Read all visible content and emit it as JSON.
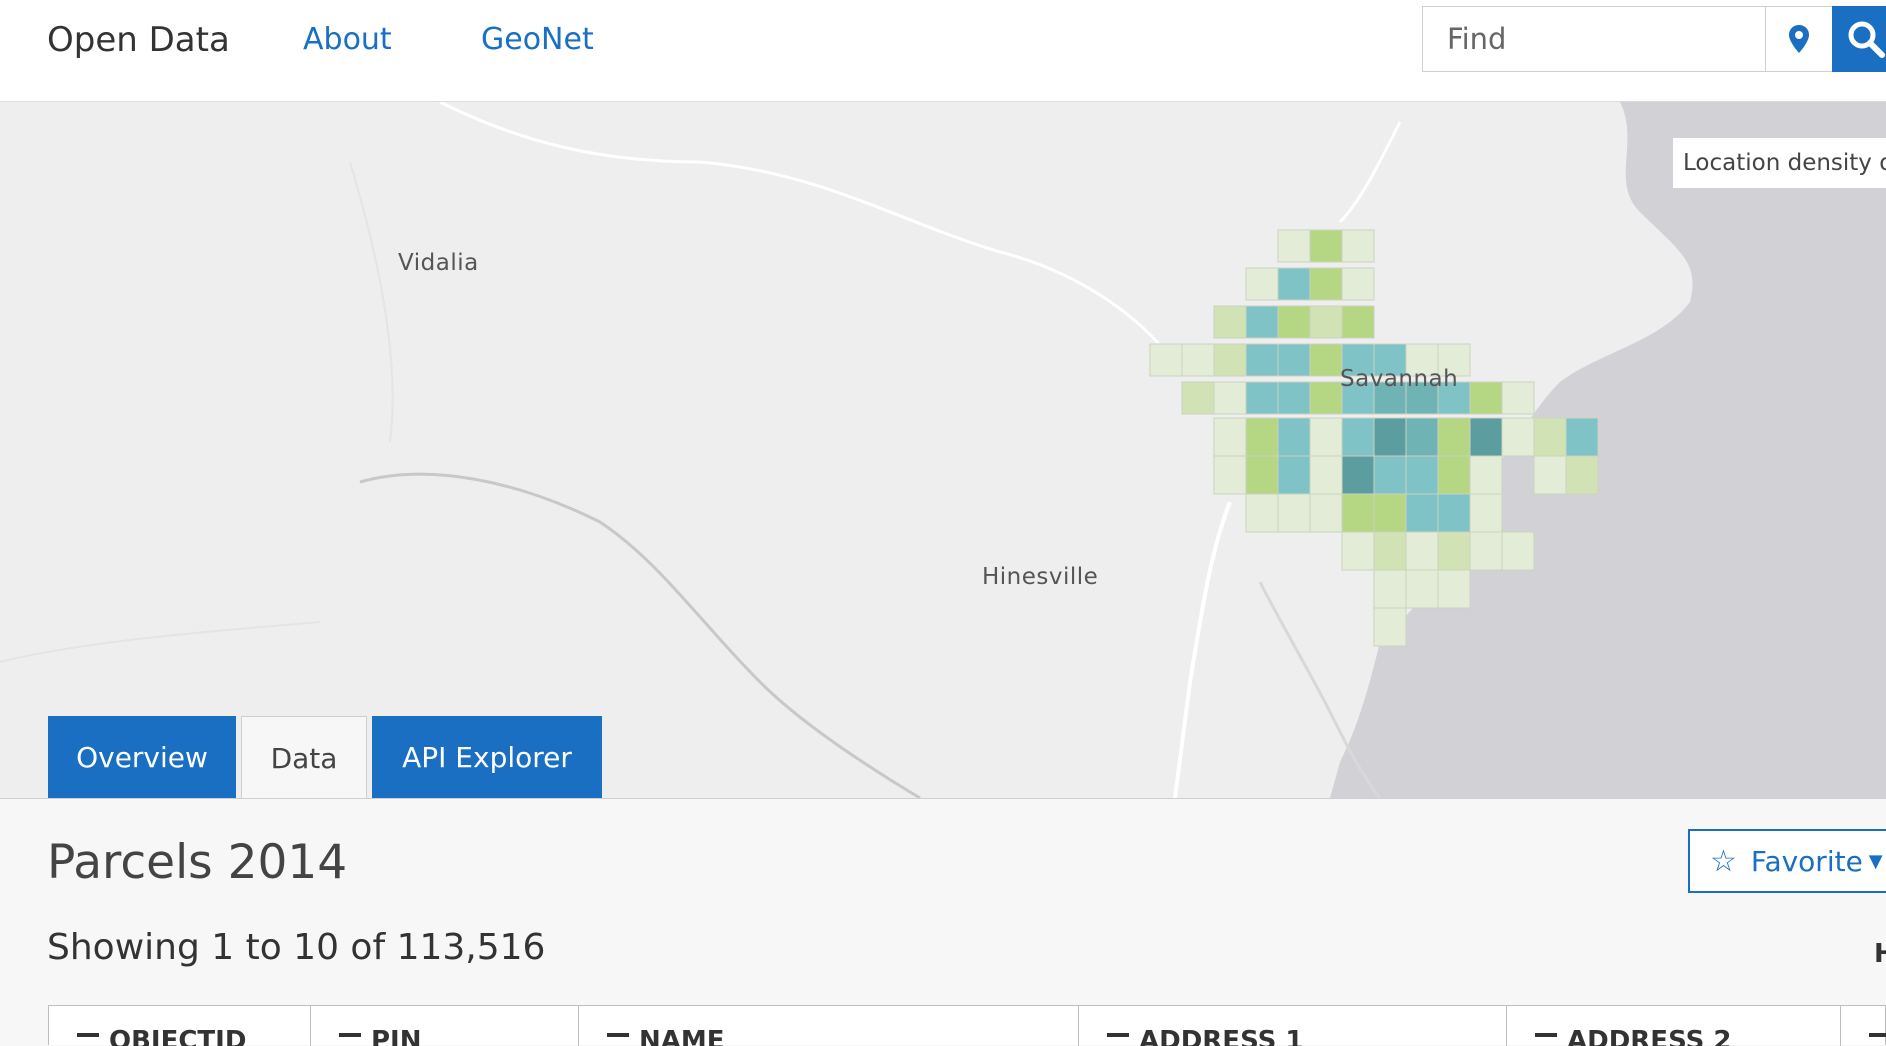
{
  "header": {
    "brand": "Open Data",
    "nav": [
      "About",
      "GeoNet"
    ],
    "search_placeholder": "Find"
  },
  "map": {
    "cities": [
      "Vidalia",
      "Savannah",
      "Hinesville"
    ],
    "legend_label": "Location density o"
  },
  "tabs": [
    {
      "label": "Overview"
    },
    {
      "label": "Data",
      "active": true
    },
    {
      "label": "API Explorer"
    }
  ],
  "dataset": {
    "title": "Parcels 2014",
    "showing": "Showing 1 to 10 of 113,516",
    "favorite_label": "Favorite",
    "stray_text": "H"
  },
  "table": {
    "columns": [
      "OBJECTID",
      "PIN",
      "NAME",
      "ADDRESS 1",
      "ADDRESS 2"
    ]
  },
  "colors": {
    "accent": "#1a6fc3",
    "density_low": "#e3ecd6",
    "density_mid": "#b5d683",
    "density_high": "#7fc3c7",
    "density_max": "#5c9ea0"
  }
}
